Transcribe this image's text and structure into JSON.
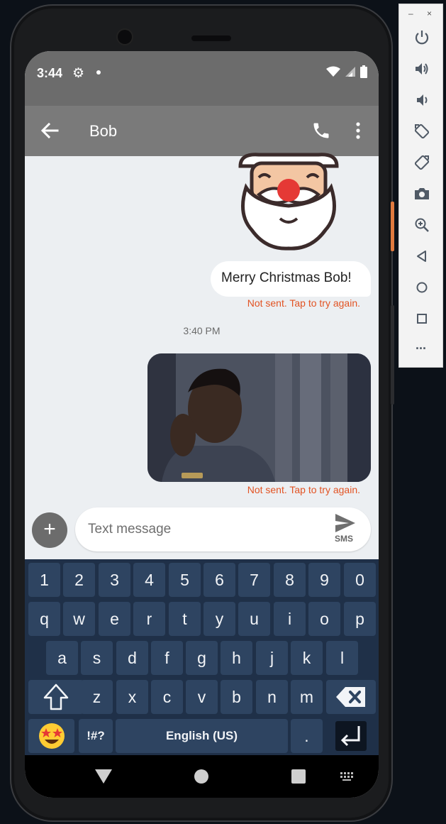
{
  "status": {
    "time": "3:44"
  },
  "appbar": {
    "contact_name": "Bob"
  },
  "messages": [
    {
      "type": "text",
      "text": "Merry Christmas Bob!",
      "error": "Not sent. Tap to try again."
    },
    {
      "type": "timestamp",
      "text": "3:40 PM"
    },
    {
      "type": "image",
      "error": "Not sent. Tap to try again."
    }
  ],
  "compose": {
    "placeholder": "Text message",
    "send_label": "SMS"
  },
  "keyboard": {
    "row_numbers": [
      "1",
      "2",
      "3",
      "4",
      "5",
      "6",
      "7",
      "8",
      "9",
      "0"
    ],
    "row1": [
      "q",
      "w",
      "e",
      "r",
      "t",
      "y",
      "u",
      "i",
      "o",
      "p"
    ],
    "row2": [
      "a",
      "s",
      "d",
      "f",
      "g",
      "h",
      "j",
      "k",
      "l"
    ],
    "row3": [
      "z",
      "x",
      "c",
      "v",
      "b",
      "n",
      "m"
    ],
    "symbols_label": "!#?",
    "space_label": "English (US)",
    "period_label": "."
  },
  "emulator": {
    "window_minimize": "–",
    "window_close": "×",
    "more_label": "..."
  },
  "colors": {
    "error": "#e25323",
    "appbar": "#7a7a7a",
    "keyboard_bg": "#1f3048",
    "key_bg": "#2e4461"
  }
}
